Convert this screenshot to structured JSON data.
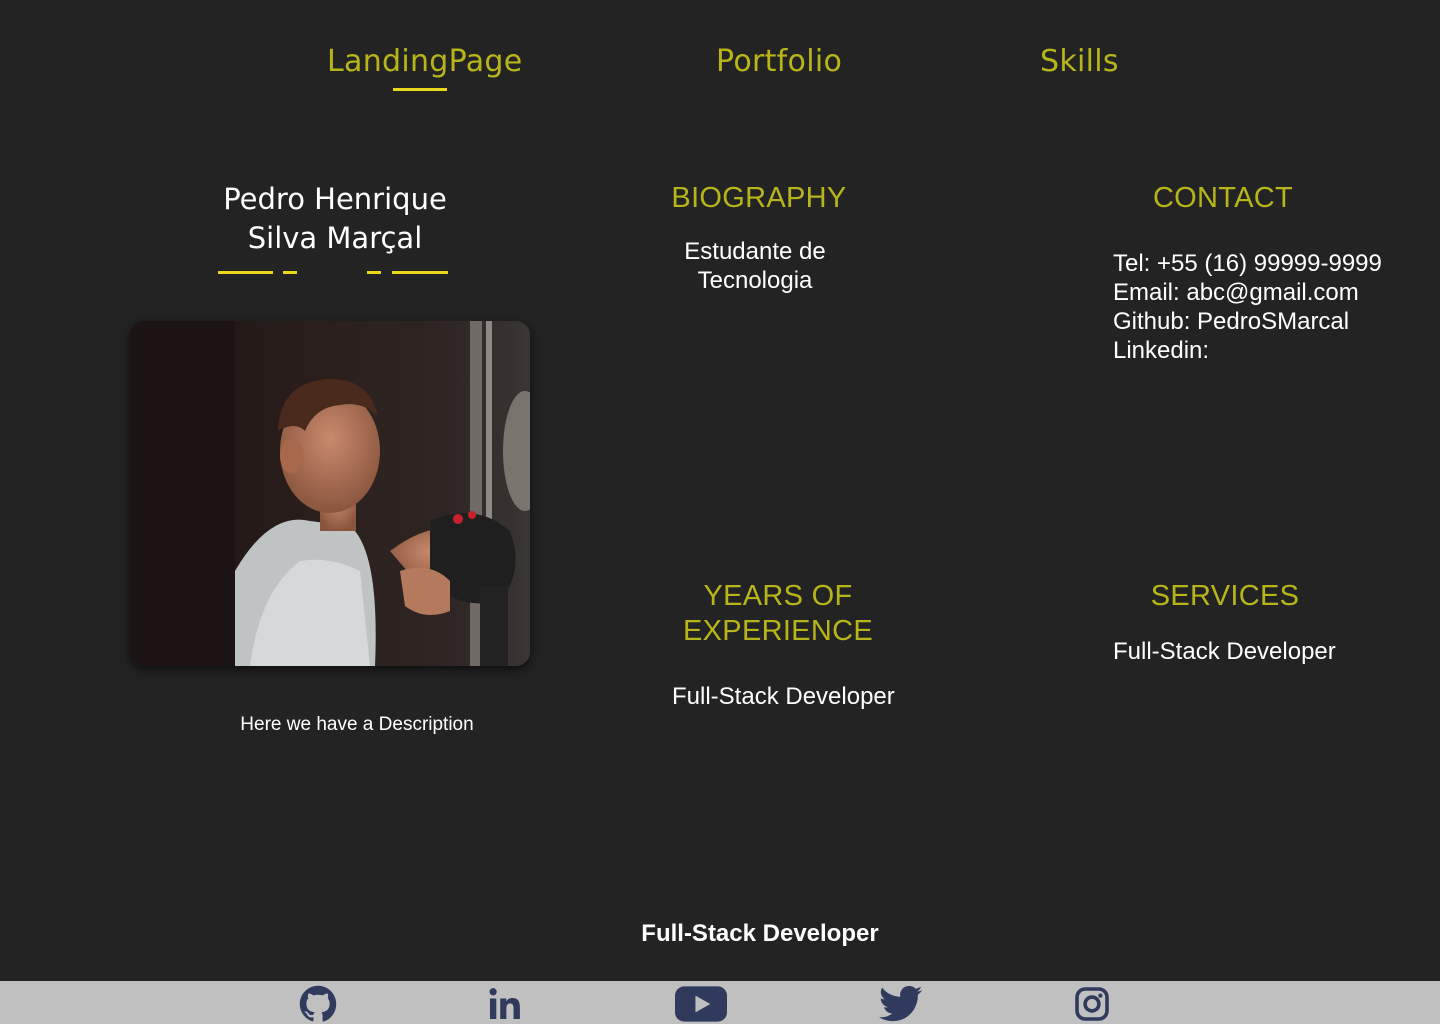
{
  "nav": {
    "items": [
      {
        "label": "LandingPage",
        "active": true
      },
      {
        "label": "Portfolio",
        "active": false
      },
      {
        "label": "Skills",
        "active": false
      }
    ]
  },
  "profile": {
    "name_line1": "Pedro Henrique",
    "name_line2": "Silva Marçal",
    "description": "Here we have a Description"
  },
  "biography": {
    "title": "BIOGRAPHY",
    "text_line1": "Estudante de",
    "text_line2": "Tecnologia"
  },
  "contact": {
    "title": "CONTACT",
    "tel": "Tel: +55 (16) 99999-9999",
    "email": "Email: abc@gmail.com",
    "github": "Github: PedroSMarcal",
    "linkedin": "Linkedin:"
  },
  "experience": {
    "title_line1": "YEARS OF",
    "title_line2": "EXPERIENCE",
    "text": "Full-Stack Developer"
  },
  "services": {
    "title": "SERVICES",
    "text": "Full-Stack Developer"
  },
  "footer": {
    "title": "Full-Stack Developer",
    "social_icons": [
      "github-icon",
      "linkedin-icon",
      "youtube-icon",
      "twitter-icon",
      "instagram-icon"
    ]
  },
  "colors": {
    "background": "#242323",
    "accent": "#b8b51a",
    "underline": "#e8d71a",
    "social_bar": "#c0c0c0",
    "social_icon": "#2f3a5c"
  }
}
